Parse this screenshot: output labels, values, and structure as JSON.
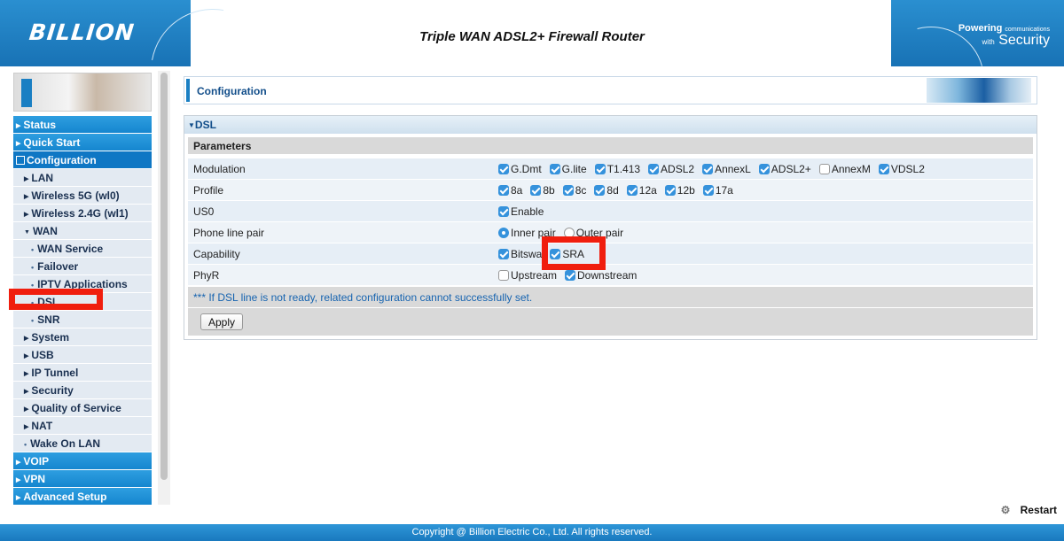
{
  "header": {
    "logo": "BILLION",
    "title": "Triple WAN ADSL2+ Firewall Router",
    "slogan_line1": "Powering",
    "slogan_line1_small": "communications",
    "slogan_with": "with",
    "slogan_line2": "Security"
  },
  "sidebar": {
    "items": [
      {
        "label": "Status",
        "level": "top"
      },
      {
        "label": "Quick Start",
        "level": "top"
      },
      {
        "label": "Configuration",
        "level": "active"
      },
      {
        "label": "LAN",
        "level": "sub"
      },
      {
        "label": "Wireless 5G (wl0)",
        "level": "sub"
      },
      {
        "label": "Wireless 2.4G (wl1)",
        "level": "sub"
      },
      {
        "label": "WAN",
        "level": "sub-open"
      },
      {
        "label": "WAN Service",
        "level": "sub2"
      },
      {
        "label": "Failover",
        "level": "sub2"
      },
      {
        "label": "IPTV Applications",
        "level": "sub2"
      },
      {
        "label": "DSL",
        "level": "sub2"
      },
      {
        "label": "SNR",
        "level": "sub2"
      },
      {
        "label": "System",
        "level": "sub"
      },
      {
        "label": "USB",
        "level": "sub"
      },
      {
        "label": "IP Tunnel",
        "level": "sub"
      },
      {
        "label": "Security",
        "level": "sub"
      },
      {
        "label": "Quality of Service",
        "level": "sub"
      },
      {
        "label": "NAT",
        "level": "sub"
      },
      {
        "label": "Wake On LAN",
        "level": "sub2-dot"
      },
      {
        "label": "VOIP",
        "level": "top"
      },
      {
        "label": "VPN",
        "level": "top"
      },
      {
        "label": "Advanced Setup",
        "level": "top"
      }
    ]
  },
  "content": {
    "banner_title": "Configuration",
    "panel_title": "DSL",
    "params_header": "Parameters",
    "rows": [
      {
        "label": "Modulation",
        "options": [
          {
            "type": "checkbox",
            "label": "G.Dmt",
            "checked": true
          },
          {
            "type": "checkbox",
            "label": "G.lite",
            "checked": true
          },
          {
            "type": "checkbox",
            "label": "T1.413",
            "checked": true
          },
          {
            "type": "checkbox",
            "label": "ADSL2",
            "checked": true
          },
          {
            "type": "checkbox",
            "label": "AnnexL",
            "checked": true
          },
          {
            "type": "checkbox",
            "label": "ADSL2+",
            "checked": true
          },
          {
            "type": "checkbox",
            "label": "AnnexM",
            "checked": false
          },
          {
            "type": "checkbox",
            "label": "VDSL2",
            "checked": true
          }
        ]
      },
      {
        "label": "Profile",
        "options": [
          {
            "type": "checkbox",
            "label": "8a",
            "checked": true
          },
          {
            "type": "checkbox",
            "label": "8b",
            "checked": true
          },
          {
            "type": "checkbox",
            "label": "8c",
            "checked": true
          },
          {
            "type": "checkbox",
            "label": "8d",
            "checked": true
          },
          {
            "type": "checkbox",
            "label": "12a",
            "checked": true
          },
          {
            "type": "checkbox",
            "label": "12b",
            "checked": true
          },
          {
            "type": "checkbox",
            "label": "17a",
            "checked": true
          }
        ]
      },
      {
        "label": "US0",
        "options": [
          {
            "type": "checkbox",
            "label": "Enable",
            "checked": true
          }
        ]
      },
      {
        "label": "Phone line pair",
        "options": [
          {
            "type": "radio",
            "label": "Inner pair",
            "checked": true
          },
          {
            "type": "radio",
            "label": "Outer pair",
            "checked": false
          }
        ]
      },
      {
        "label": "Capability",
        "options": [
          {
            "type": "checkbox",
            "label": "Bitswa",
            "checked": true
          },
          {
            "type": "checkbox",
            "label": "SRA",
            "checked": true
          }
        ]
      },
      {
        "label": "PhyR",
        "options": [
          {
            "type": "checkbox",
            "label": "Upstream",
            "checked": false
          },
          {
            "type": "checkbox",
            "label": "Downstream",
            "checked": true
          }
        ]
      }
    ],
    "note": "*** If DSL line is not ready, related configuration cannot successfully set.",
    "apply_label": "Apply"
  },
  "restart_label": "Restart",
  "footer": "Copyright @ Billion Electric Co., Ltd. All rights reserved.",
  "colors": {
    "accent": "#1a7fc3",
    "highlight": "#f01e0e",
    "checkbox": "#3592dc"
  }
}
